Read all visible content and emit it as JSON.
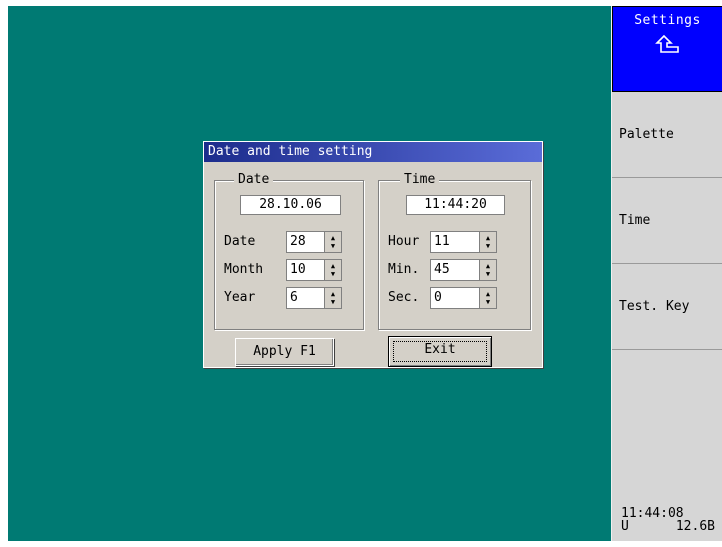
{
  "sidebar": {
    "settings_label": "Settings",
    "items": [
      {
        "label": "Palette"
      },
      {
        "label": "Time"
      },
      {
        "label": "Test. Key"
      }
    ],
    "status_time": "11:44:08",
    "status_unit": "U",
    "status_voltage": "12.6B"
  },
  "dialog": {
    "title": "Date and time setting",
    "date_group": {
      "legend": "Date",
      "display": "28.10.06",
      "fields": [
        {
          "label": "Date",
          "value": "28"
        },
        {
          "label": "Month",
          "value": "10"
        },
        {
          "label": "Year",
          "value": "6"
        }
      ]
    },
    "time_group": {
      "legend": "Time",
      "display": "11:44:20",
      "fields": [
        {
          "label": "Hour",
          "value": "11"
        },
        {
          "label": "Min.",
          "value": "45"
        },
        {
          "label": "Sec.",
          "value": "0"
        }
      ]
    },
    "apply_label": "Apply F1",
    "exit_label": "Exit"
  },
  "colors": {
    "desktop": "#007a73",
    "sidebar": "#d6d6d6",
    "settings_active": "#0000ff",
    "title_bar": "#1c2c8c"
  }
}
